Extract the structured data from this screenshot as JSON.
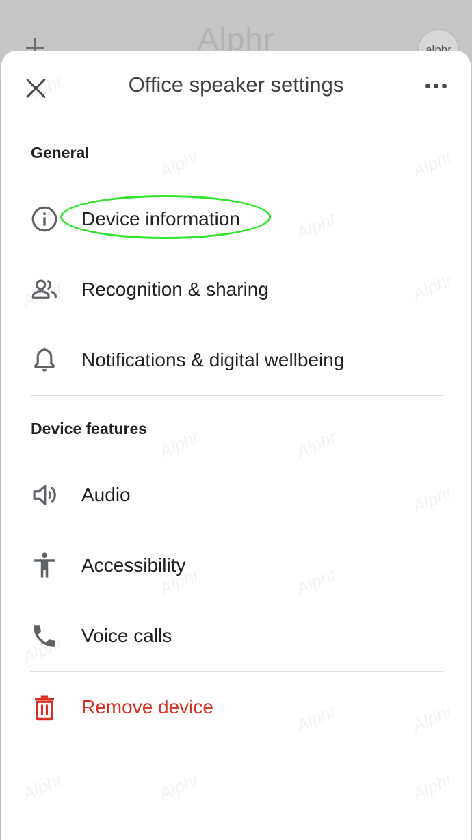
{
  "backdrop": {
    "brand": "Alphr",
    "avatar_text": "alphr"
  },
  "header": {
    "title": "Office speaker settings"
  },
  "sections": [
    {
      "header": "General",
      "items": [
        {
          "label": "Device information",
          "icon": "info-icon"
        },
        {
          "label": "Recognition & sharing",
          "icon": "people-icon"
        },
        {
          "label": "Notifications & digital wellbeing",
          "icon": "bell-icon"
        }
      ]
    },
    {
      "header": "Device features",
      "items": [
        {
          "label": "Audio",
          "icon": "speaker-icon"
        },
        {
          "label": "Accessibility",
          "icon": "accessibility-icon"
        },
        {
          "label": "Voice calls",
          "icon": "phone-icon"
        }
      ]
    }
  ],
  "danger": {
    "label": "Remove device",
    "icon": "trash-icon"
  },
  "watermark": "Alphr",
  "colors": {
    "danger": "#d93025",
    "highlight": "#2ee52a",
    "text": "#202124",
    "icon": "#5f6368"
  }
}
